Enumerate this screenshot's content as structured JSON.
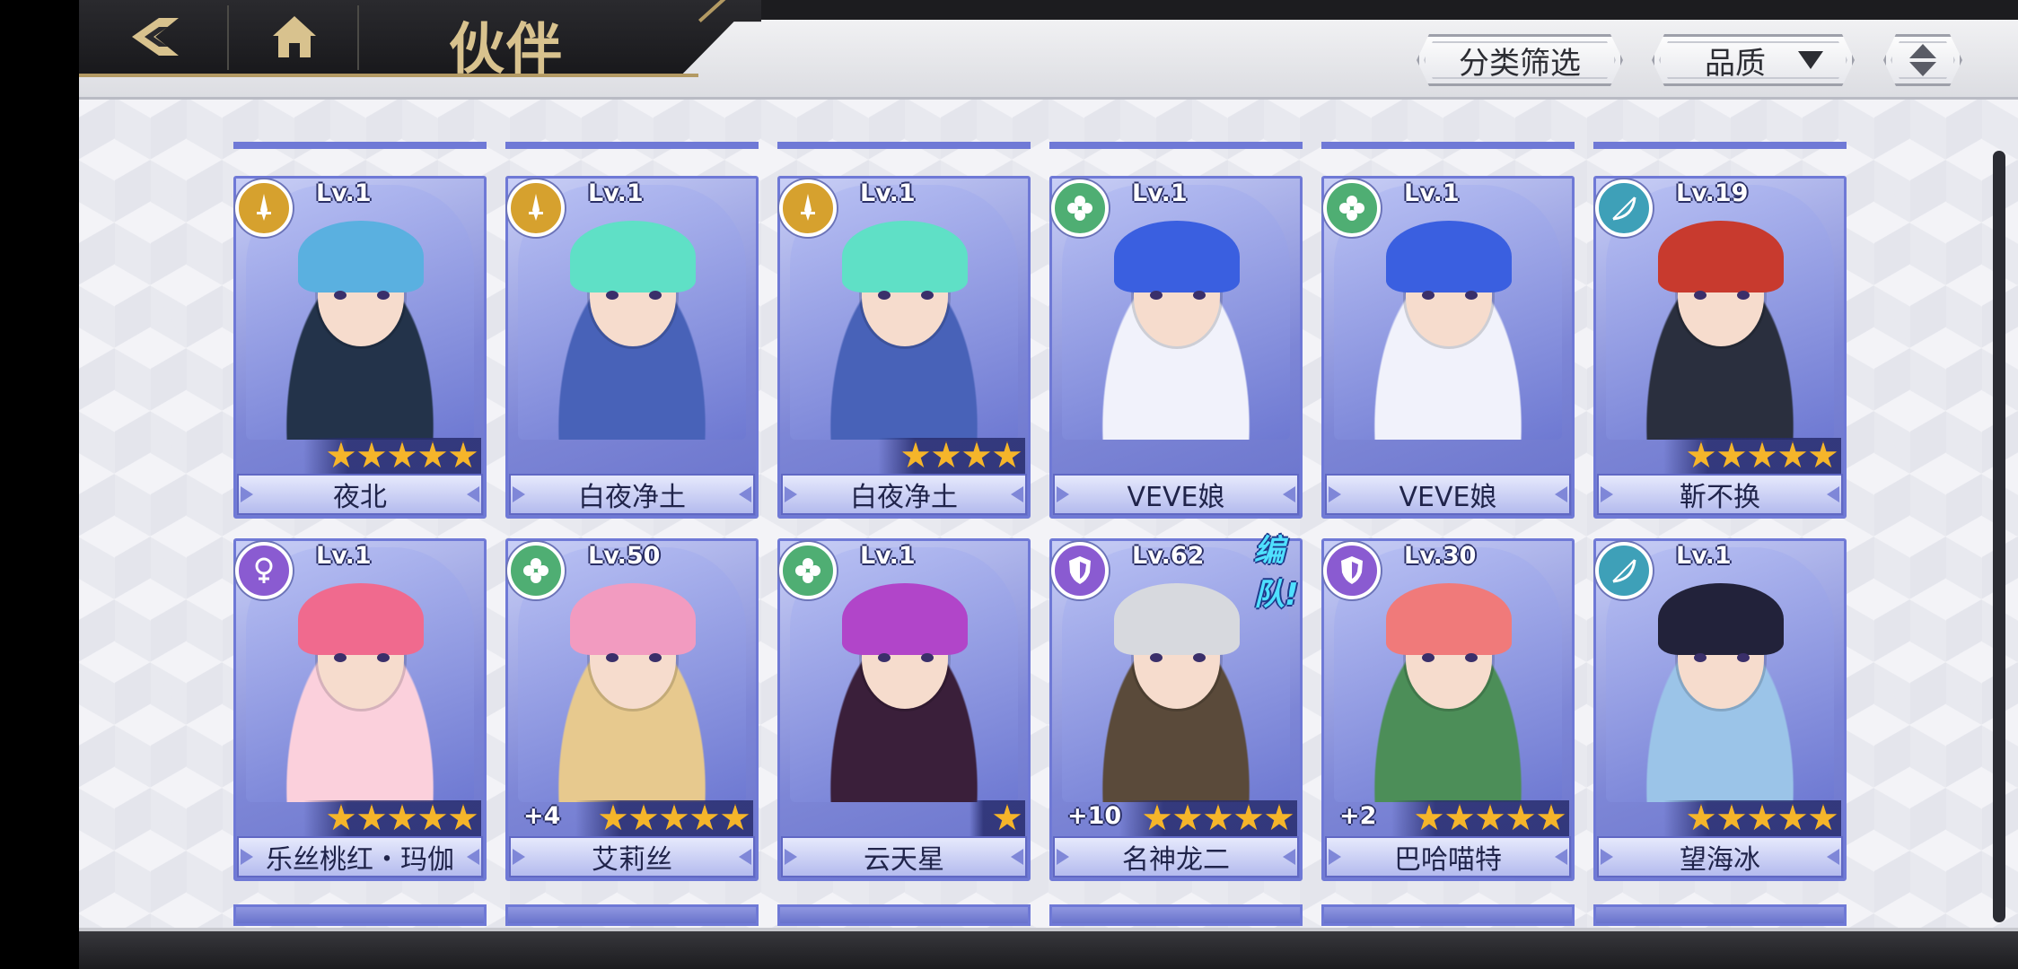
{
  "header": {
    "title": "伙伴",
    "filter_label": "分类筛选",
    "sort_label": "品质"
  },
  "colors": {
    "card_frame": "#6f79d6",
    "star": "#f5b52a",
    "badge_gold": "#d6a12e",
    "badge_green": "#4fae73",
    "badge_teal": "#3ea0b8",
    "badge_purple": "#8a5bd1",
    "title_gold": "#d8c28e"
  },
  "cards": [
    {
      "name": "夜北",
      "level": "Lv.1",
      "stars": 5,
      "plus": "",
      "team": "",
      "badge": "gold",
      "badge_icon": "sword-icon"
    },
    {
      "name": "白夜净土",
      "level": "Lv.1",
      "stars": 0,
      "plus": "",
      "team": "",
      "badge": "gold",
      "badge_icon": "sword-icon"
    },
    {
      "name": "白夜净土",
      "level": "Lv.1",
      "stars": 4,
      "plus": "",
      "team": "",
      "badge": "gold",
      "badge_icon": "sword-icon"
    },
    {
      "name": "VEVE娘",
      "level": "Lv.1",
      "stars": 0,
      "plus": "",
      "team": "",
      "badge": "green",
      "badge_icon": "clover-icon"
    },
    {
      "name": "VEVE娘",
      "level": "Lv.1",
      "stars": 0,
      "plus": "",
      "team": "",
      "badge": "green",
      "badge_icon": "clover-icon"
    },
    {
      "name": "靳不换",
      "level": "Lv.19",
      "stars": 5,
      "plus": "",
      "team": "",
      "badge": "teal",
      "badge_icon": "bow-icon"
    },
    {
      "name": "乐丝桃红・玛伽",
      "level": "Lv.1",
      "stars": 5,
      "plus": "",
      "team": "",
      "badge": "purple",
      "badge_icon": "venus-icon"
    },
    {
      "name": "艾莉丝",
      "level": "Lv.50",
      "stars": 5,
      "plus": "+4",
      "team": "",
      "badge": "green",
      "badge_icon": "clover-icon"
    },
    {
      "name": "云天星",
      "level": "Lv.1",
      "stars": 1,
      "plus": "",
      "team": "",
      "badge": "green",
      "badge_icon": "clover-icon"
    },
    {
      "name": "名神龙二",
      "level": "Lv.62",
      "stars": 5,
      "plus": "+10",
      "team": "编队!",
      "badge": "purple",
      "badge_icon": "shield-icon"
    },
    {
      "name": "巴哈喵特",
      "level": "Lv.30",
      "stars": 5,
      "plus": "+2",
      "team": "",
      "badge": "purple",
      "badge_icon": "shield-icon"
    },
    {
      "name": "望海冰",
      "level": "Lv.1",
      "stars": 5,
      "plus": "",
      "team": "",
      "badge": "teal",
      "badge_icon": "bow-icon"
    }
  ]
}
